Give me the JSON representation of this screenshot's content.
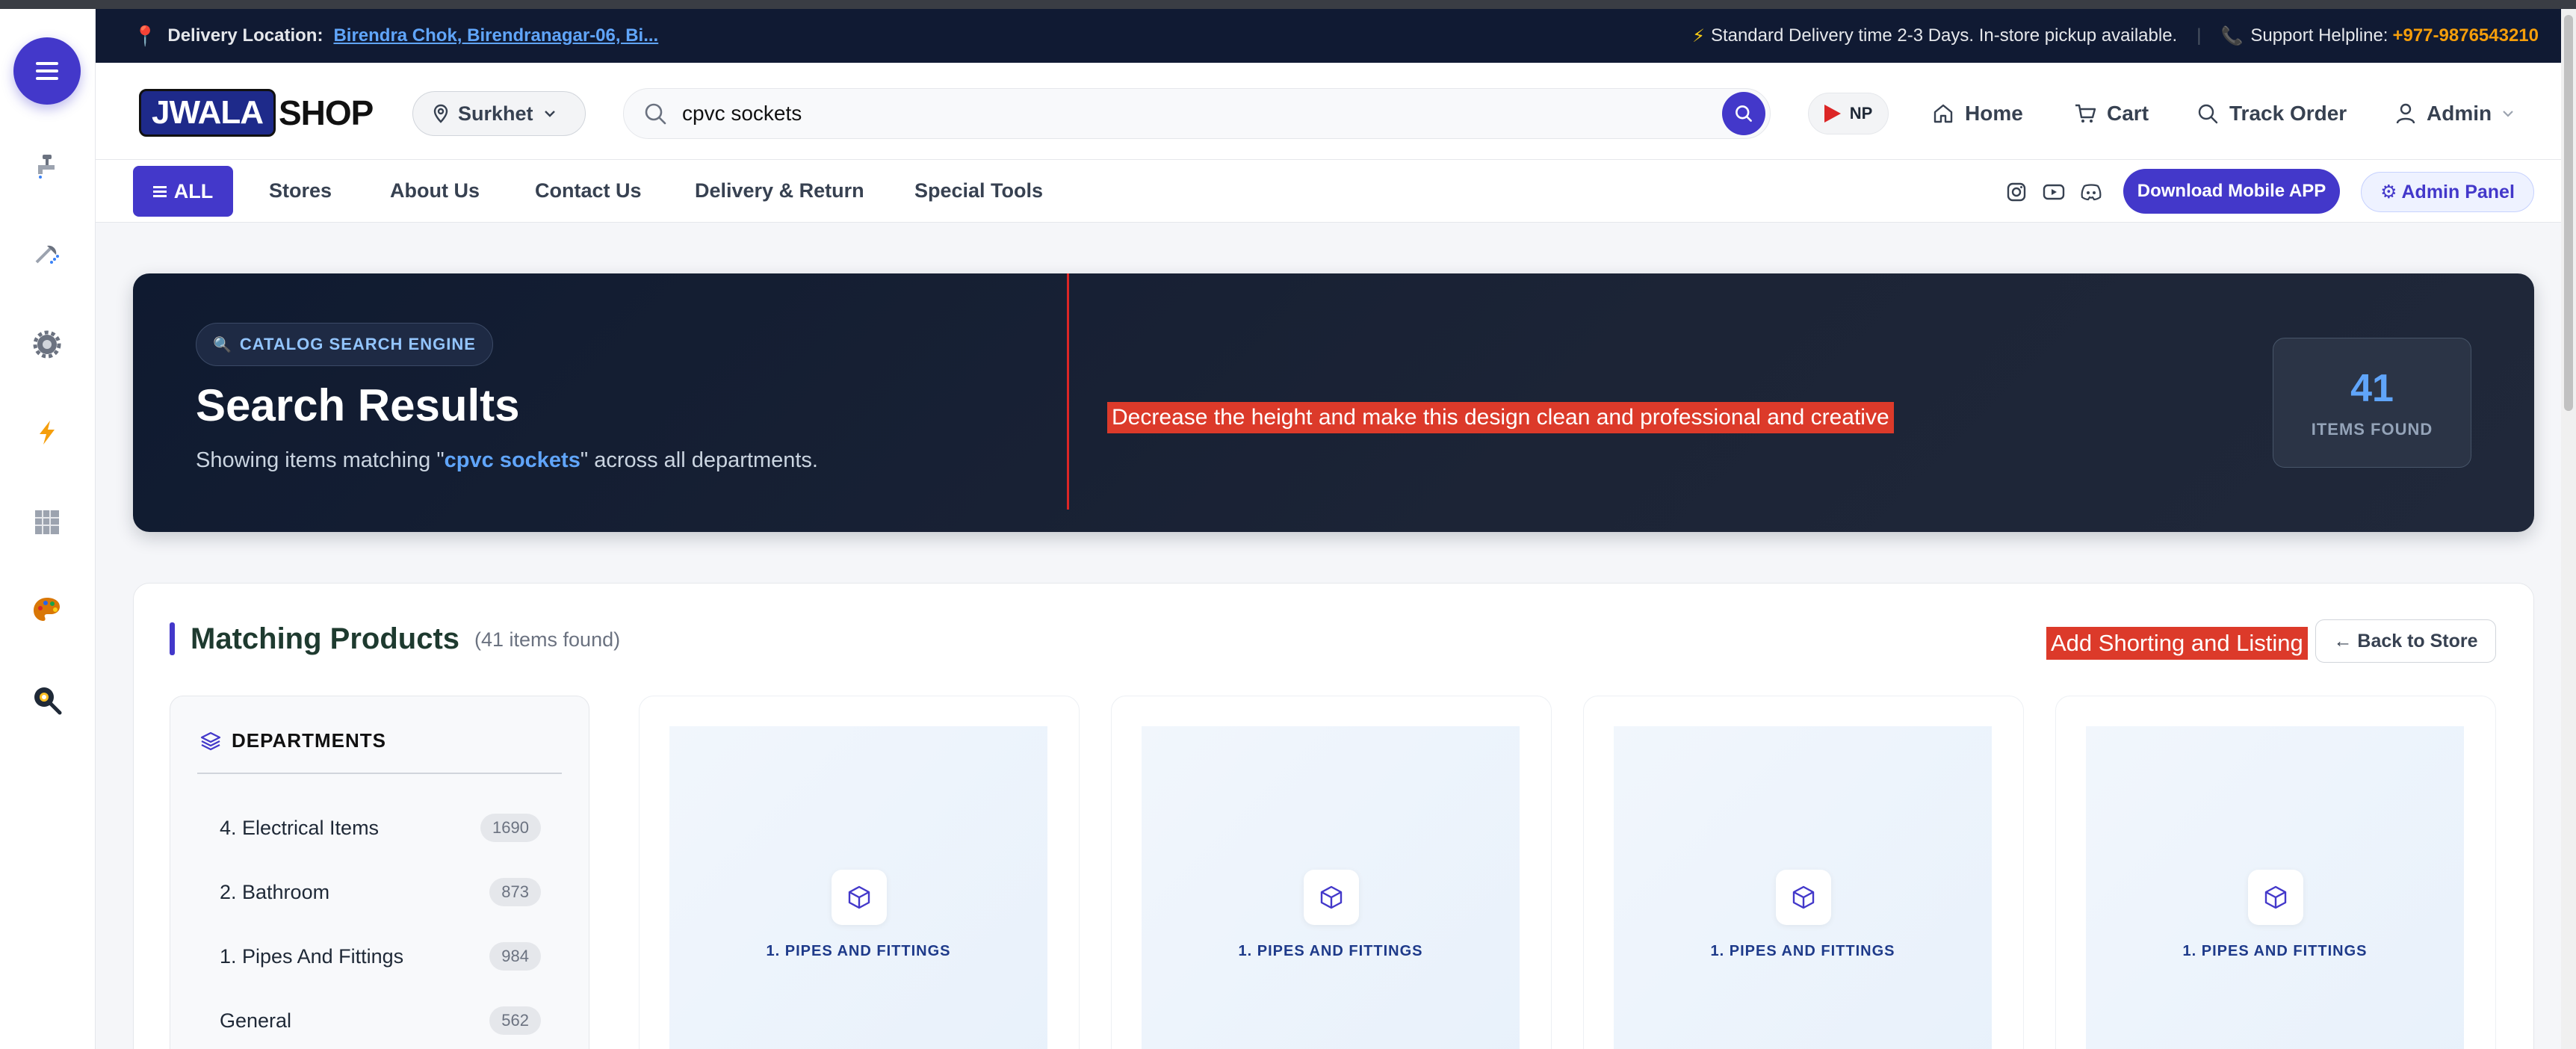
{
  "topbar": {
    "delivery_label": "Delivery Location:",
    "delivery_value": "Birendra Chok, Birendranagar-06, Bi...",
    "standard_delivery": "Standard Delivery time 2-3 Days. In-store pickup available.",
    "support_label": "Support Helpline:",
    "support_number": "+977-9876543210"
  },
  "header": {
    "logo_part1": "JWALA",
    "logo_part2": "SHOP",
    "location": "Surkhet",
    "search_value": "cpvc sockets",
    "language": "NP",
    "nav": {
      "home": "Home",
      "cart": "Cart",
      "track": "Track Order",
      "admin": "Admin"
    }
  },
  "subnav": {
    "all": "ALL",
    "items": [
      "Stores",
      "About Us",
      "Contact Us",
      "Delivery & Return",
      "Special Tools"
    ],
    "download_app": "Download Mobile APP",
    "admin_panel": "⚙ Admin Panel"
  },
  "hero": {
    "badge": "CATALOG SEARCH ENGINE",
    "title": "Search Results",
    "sub_prefix": "Showing items matching \"",
    "sub_query": "cpvc sockets",
    "sub_suffix": "\" across all departments.",
    "note": "Decrease the height and make this design clean and professional and creative",
    "stat_value": "41",
    "stat_label": "ITEMS FOUND"
  },
  "products": {
    "title": "Matching Products",
    "count": "(41 items found)",
    "sort_note": "Add Shorting and Listing",
    "back": "← Back to Store",
    "departments_title": "DEPARTMENTS",
    "departments": [
      {
        "name": "4. Electrical Items",
        "count": "1690"
      },
      {
        "name": "2. Bathroom",
        "count": "873"
      },
      {
        "name": "1. Pipes And Fittings",
        "count": "984"
      },
      {
        "name": "General",
        "count": "562"
      }
    ],
    "cards": [
      {
        "category": "1. PIPES AND FITTINGS"
      },
      {
        "category": "1. PIPES AND FITTINGS"
      },
      {
        "category": "1. PIPES AND FITTINGS"
      },
      {
        "category": "1. PIPES AND FITTINGS"
      }
    ]
  },
  "dock_icons": [
    "faucet-icon",
    "shower-icon",
    "gear-icon",
    "lightning-icon",
    "grid-tile-icon",
    "paint-palette-icon",
    "frying-pan-icon"
  ],
  "colors": {
    "accent": "#4338ca",
    "topbar_bg": "#101a33",
    "hero_bg": "#0f1a30",
    "annotation_red": "#dc3a2a",
    "helpline": "#f59e0b"
  }
}
